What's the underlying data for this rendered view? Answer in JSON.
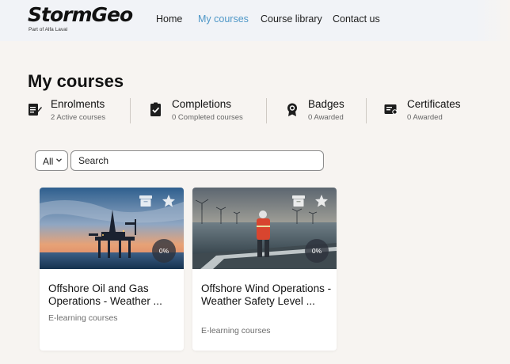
{
  "brand": {
    "name": "StormGeo",
    "tagline": "Part of Alfa Laval"
  },
  "nav": [
    {
      "label": "Home",
      "active": false
    },
    {
      "label": "My courses",
      "active": true
    },
    {
      "label": "Course library",
      "active": false
    },
    {
      "label": "Contact us",
      "active": false
    }
  ],
  "colors": {
    "accent": "#4e97c7",
    "background": "#f7f4f1",
    "header": "#f1f3f7"
  },
  "page_title": "My courses",
  "stats": [
    {
      "icon": "enrolment-icon",
      "label": "Enrolments",
      "sub": "2 Active courses"
    },
    {
      "icon": "completion-icon",
      "label": "Completions",
      "sub": "0 Completed courses"
    },
    {
      "icon": "badge-icon",
      "label": "Badges",
      "sub": "0 Awarded"
    },
    {
      "icon": "certificate-icon",
      "label": "Certificates",
      "sub": "0 Awarded"
    }
  ],
  "filter": {
    "selected": "All",
    "search_placeholder": "Search"
  },
  "courses": [
    {
      "title": "Offshore Oil and Gas Operations - Weather ...",
      "category": "E-learning courses",
      "progress": "0%",
      "image": "offshore oil rig at sunset"
    },
    {
      "title": "Offshore Wind Operations - Weather Safety Level ...",
      "category": "E-learning courses",
      "progress": "0%",
      "image": "worker on vessel facing wind farm"
    }
  ]
}
